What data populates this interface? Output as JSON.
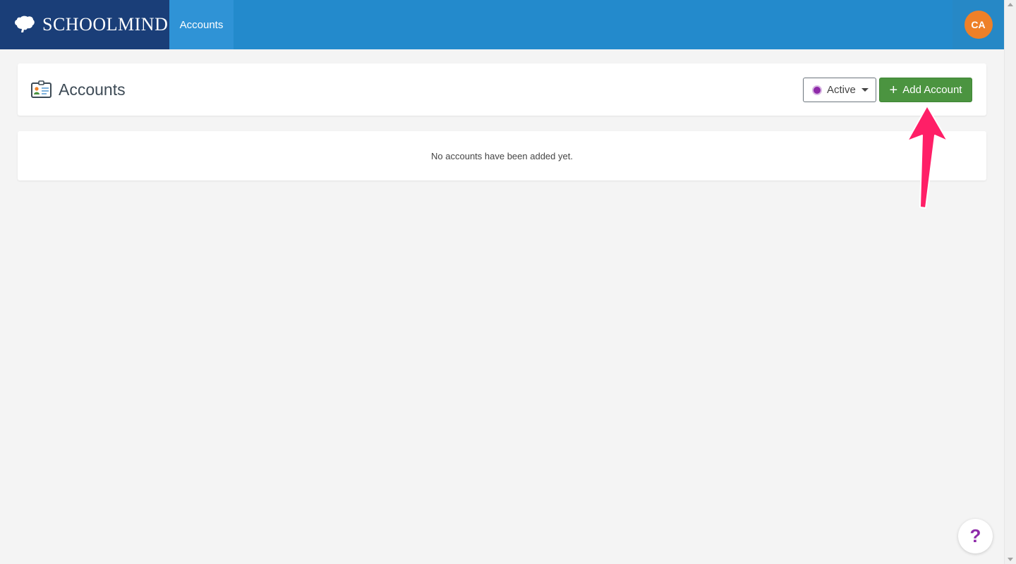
{
  "brand": {
    "name": "SchoolMind"
  },
  "nav": {
    "accounts_label": "Accounts"
  },
  "user": {
    "initials": "CA",
    "avatar_color": "#ee8028"
  },
  "page": {
    "title": "Accounts",
    "status_filter": {
      "selected": "Active",
      "dot_color": "#8e2aa9"
    },
    "add_button_label": "Add Account",
    "empty_message": "No accounts have been added yet."
  },
  "help": {
    "label": "?"
  },
  "colors": {
    "topbar": "#238acc",
    "brand_bg": "#1a3e78",
    "add_button": "#4b9440",
    "callout_arrow": "#ff1f67"
  }
}
